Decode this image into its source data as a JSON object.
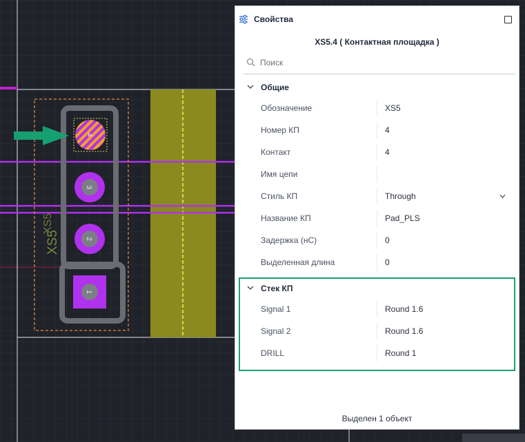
{
  "panel": {
    "title": "Свойства",
    "object_title": "XS5.4 ( Контактная площадка )",
    "search_placeholder": "Поиск",
    "general": {
      "header": "Общие",
      "rows": [
        {
          "key": "Обозначение",
          "value": "XS5"
        },
        {
          "key": "Номер КП",
          "value": "4"
        },
        {
          "key": "Контакт",
          "value": "4"
        },
        {
          "key": "Имя цепи",
          "value": ""
        },
        {
          "key": "Стиль КП",
          "value": "Through"
        },
        {
          "key": "Название КП",
          "value": "Pad_PLS"
        },
        {
          "key": "Задержка (нС)",
          "value": "0"
        },
        {
          "key": "Выделенная длина",
          "value": "0"
        }
      ]
    },
    "stack": {
      "header": "Стек КП",
      "rows": [
        {
          "key": "Signal 1",
          "value": "Round 1.6"
        },
        {
          "key": "Signal 2",
          "value": "Round 1.6"
        },
        {
          "key": "DRILL",
          "value": "Round 1"
        }
      ]
    },
    "footer": "Выделен 1 объект"
  },
  "board": {
    "component_labels": [
      "XS5",
      "XS5"
    ],
    "pins": [
      "4",
      "3",
      "2",
      "1"
    ],
    "colors": {
      "background": "#1f2229",
      "pad_purple": "#b031ee",
      "selected_orange": "#f2a320",
      "copper_track": "#8a8a1e",
      "arrow_green": "#16a071",
      "courtyard_orange": "#c8783a",
      "highlight_green": "#19a077"
    }
  }
}
